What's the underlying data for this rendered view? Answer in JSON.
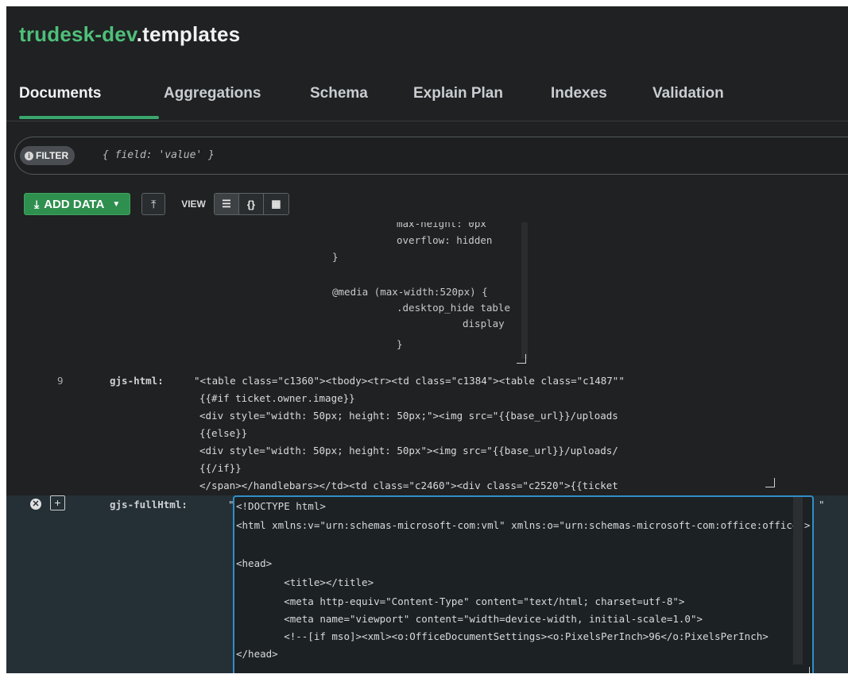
{
  "header": {
    "db": "trudesk-dev",
    "collection": ".templates"
  },
  "tabs": [
    {
      "label": "Documents"
    },
    {
      "label": "Aggregations"
    },
    {
      "label": "Schema"
    },
    {
      "label": "Explain Plan"
    },
    {
      "label": "Indexes"
    },
    {
      "label": "Validation"
    }
  ],
  "filter": {
    "label": "FILTER",
    "placeholder": "{ field: 'value' }"
  },
  "toolbar": {
    "add_data": "ADD DATA",
    "view_label": "VIEW"
  },
  "css_snippet": [
    "max-height: 0px",
    "overflow: hidden",
    "}",
    "@media (max-width:520px) {",
    ".desktop_hide table",
    "display"
  ],
  "field_html": {
    "line_no": "9",
    "key": "gjs-html:",
    "lines": [
      "\"<table class=\"c1360\"><tbody><tr><td class=\"c1384\"><table class=\"c1487\"\"",
      "{{#if ticket.owner.image}}",
      "<div style=\"width: 50px; height: 50px;\"><img src=\"{{base_url}}/uploads",
      "{{else}}",
      "<div style=\"width: 50px; height: 50px\"><img src=\"{{base_url}}/uploads/",
      "{{/if}}",
      "</span></handlebars></td><td class=\"c2460\"><div class=\"c2520\">{{ticket"
    ]
  },
  "field_full": {
    "key": "gjs-fullHtml:",
    "open_quote": "\"",
    "close_quote": "\"",
    "lines": [
      "<!DOCTYPE html>",
      "<html xmlns:v=\"urn:schemas-microsoft-com:vml\" xmlns:o=\"urn:schemas-microsoft-com:office:office\">",
      "",
      "<head>",
      "        <title></title>",
      "        <meta http-equiv=\"Content-Type\" content=\"text/html; charset=utf-8\">",
      "        <meta name=\"viewport\" content=\"width=device-width, initial-scale=1.0\">",
      "        <!--[if mso]><xml><o:OfficeDocumentSettings><o:PixelsPerInch>96</o:PixelsPerInch>",
      "</head>"
    ]
  }
}
